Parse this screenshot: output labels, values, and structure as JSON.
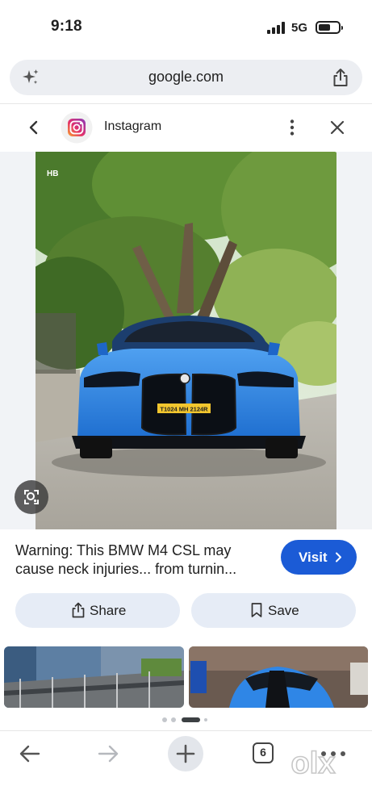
{
  "status_bar": {
    "time": "9:18",
    "network": "5G"
  },
  "url_bar": {
    "domain": "google.com"
  },
  "source": {
    "name": "Instagram"
  },
  "image": {
    "plate_text": "T1024 MH 2124R",
    "watermark": "HB"
  },
  "result": {
    "title_line1": "Warning: This BMW M4 CSL may",
    "title_line2": "cause neck injuries... from turnin...",
    "visit_label": "Visit"
  },
  "actions": {
    "share_label": "Share",
    "save_label": "Save"
  },
  "bottom_nav": {
    "tab_count": "6"
  },
  "overlay": {
    "watermark": "olx"
  },
  "colors": {
    "accent": "#1b5bd6",
    "car_blue": "#2f86e6",
    "pill_bg": "#e6ecf6"
  },
  "icons": [
    "sparkle-icon",
    "share-icon",
    "chevron-left-icon",
    "instagram-logo-icon",
    "more-vert-icon",
    "close-icon",
    "lens-icon",
    "chevron-right-icon",
    "bookmark-icon",
    "arrow-back-icon",
    "arrow-forward-icon",
    "plus-icon",
    "tabs-icon",
    "more-horiz-icon"
  ]
}
